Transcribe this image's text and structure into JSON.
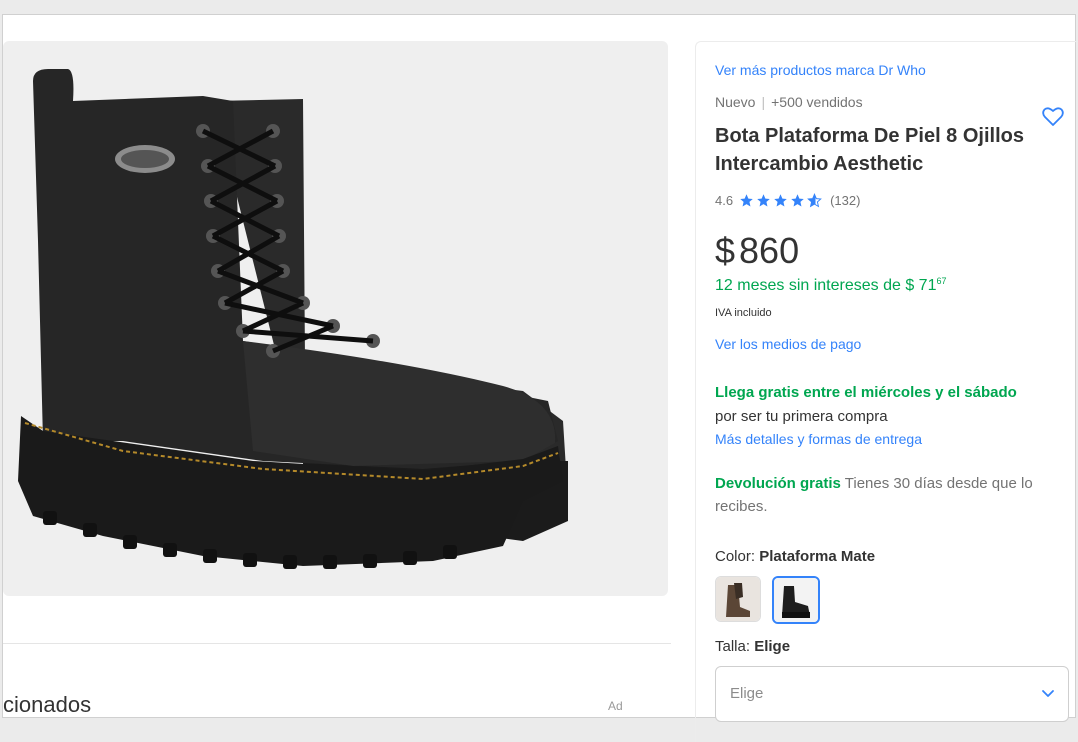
{
  "main": {
    "section_title": "cionados",
    "ad_label": "Ad"
  },
  "product": {
    "brand_link": "Ver más productos marca Dr Who",
    "condition": "Nuevo",
    "sold": "+500 vendidos",
    "title": "Bota Plataforma De Piel 8 Ojillos Intercambio Aesthetic",
    "rating_value": "4.6",
    "rating_stars": 4.6,
    "review_count": "(132)",
    "currency_symbol": "$",
    "price": "860",
    "installments_text": "12 meses sin intereses de $ 71",
    "installments_cents": "67",
    "iva": "IVA incluido",
    "payment_link": "Ver los medios de pago",
    "shipping_headline": "Llega gratis entre el miércoles y el sábado",
    "shipping_note": "por ser tu primera compra",
    "shipping_link": "Más detalles y formas de entrega",
    "return_label": "Devolución gratis",
    "return_text": "Tienes 30 días desde que lo recibes.",
    "color_label": "Color:",
    "color_value": "Plataforma Mate",
    "size_label": "Talla:",
    "size_value": "Elige",
    "size_select_placeholder": "Elige",
    "icons": {
      "favorite": "heart-icon",
      "rating": "star-icon",
      "dropdown": "chevron-down-icon"
    }
  },
  "colors": {
    "link": "#3483fa",
    "green": "#00a650",
    "star": "#3483fa"
  }
}
